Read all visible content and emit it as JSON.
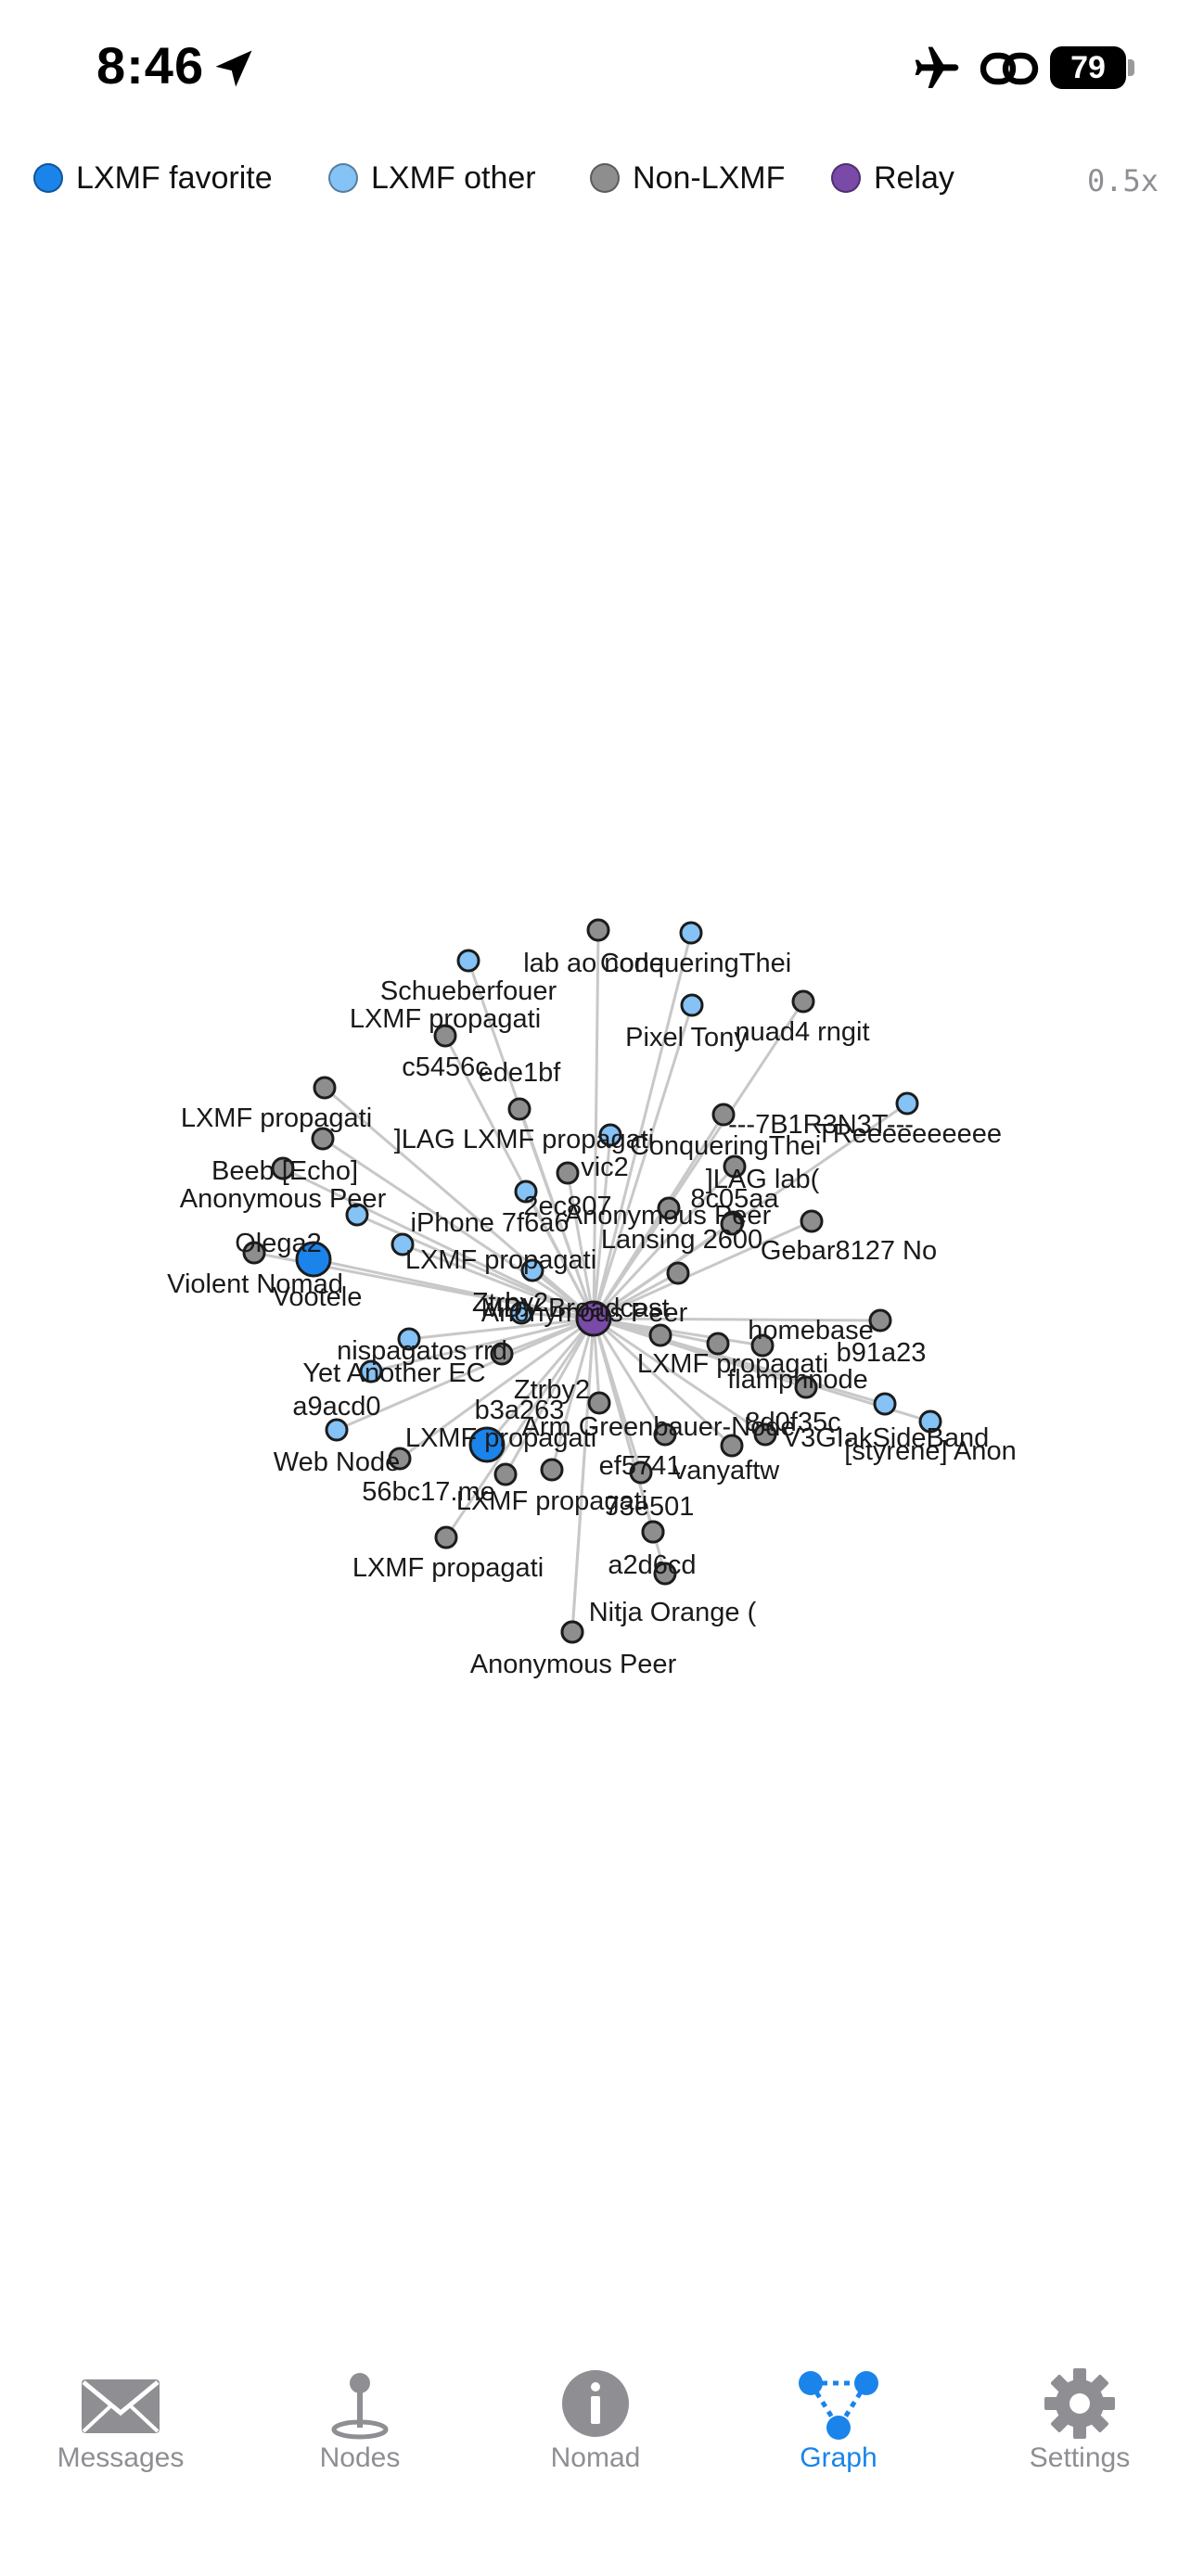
{
  "status_bar": {
    "time": "8:46",
    "battery": "79"
  },
  "legend": {
    "items": [
      {
        "label": "LXMF favorite",
        "color": "#1a84ea"
      },
      {
        "label": "LXMF other",
        "color": "#85c2f5"
      },
      {
        "label": "Non-LXMF",
        "color": "#8e8e8e"
      },
      {
        "label": "Relay",
        "color": "#7a4aa8"
      }
    ],
    "zoom": "0.5x"
  },
  "graph": {
    "edge_color": "#c8c8c8",
    "nodes": [
      {
        "label": "MDV Broadcast",
        "kind": "relay"
      },
      {
        "label": "Olega2",
        "kind": "favorite"
      },
      {
        "label": "LXMF propagati",
        "kind": "favorite"
      },
      {
        "label": "lab ao node",
        "kind": "non"
      },
      {
        "label": "ConqueringThei",
        "kind": "other"
      },
      {
        "label": "Schueberfouer",
        "kind": "other"
      },
      {
        "label": "LXMF propagati",
        "kind": "non"
      },
      {
        "label": "Pixel Tony",
        "kind": "other"
      },
      {
        "label": "nuad4 rngit",
        "kind": "non"
      },
      {
        "label": "c5456c",
        "kind": "non"
      },
      {
        "label": "ede1bf",
        "kind": "non"
      },
      {
        "label": "LXMF propagati",
        "kind": "non"
      },
      {
        "label": "]LAG LXMF propagati",
        "kind": "other"
      },
      {
        "label": "---7B1R3N3T---",
        "kind": "non"
      },
      {
        "label": "ConqueringThei",
        "kind": "non"
      },
      {
        "label": "TReeeeeeeeee",
        "kind": "other"
      },
      {
        "label": "Beeb [Echo]",
        "kind": "non"
      },
      {
        "label": "vic2",
        "kind": "non"
      },
      {
        "label": "]LAG lab(",
        "kind": "non"
      },
      {
        "label": "Anonymous Peer",
        "kind": "other"
      },
      {
        "label": "2ec807",
        "kind": "other"
      },
      {
        "label": "8c05aa",
        "kind": "non"
      },
      {
        "label": "iPhone 7f6a6",
        "kind": "other"
      },
      {
        "label": "Anonymous Peer",
        "kind": "non"
      },
      {
        "label": "Lansing 2600",
        "kind": "non"
      },
      {
        "label": "LXMF propagati",
        "kind": "other"
      },
      {
        "label": "Gebar8127 No",
        "kind": "non"
      },
      {
        "label": "Violent Nomad",
        "kind": "non"
      },
      {
        "label": "Vootele",
        "kind": "other"
      },
      {
        "label": "Ztrby2",
        "kind": "other"
      },
      {
        "label": "Anonymous Peer",
        "kind": "non"
      },
      {
        "label": "homebase",
        "kind": "non"
      },
      {
        "label": "nispagatos rrd",
        "kind": "other"
      },
      {
        "label": "b91a23",
        "kind": "non"
      },
      {
        "label": "Yet Another EC",
        "kind": "non"
      },
      {
        "label": "LXMF propagati",
        "kind": "non"
      },
      {
        "label": "flamphnode",
        "kind": "non"
      },
      {
        "label": "Ztrby2",
        "kind": "non"
      },
      {
        "label": "a9acd0",
        "kind": "other"
      },
      {
        "label": "b3a263",
        "kind": "non"
      },
      {
        "label": "Arm Greenbauer-Node",
        "kind": "non"
      },
      {
        "label": "8d0f35c",
        "kind": "non"
      },
      {
        "label": "V3GIakSideBand",
        "kind": "other"
      },
      {
        "label": "Web Node",
        "kind": "non"
      },
      {
        "label": "[styrene] Anon",
        "kind": "other"
      },
      {
        "label": "ef5741",
        "kind": "non"
      },
      {
        "label": "vanyaftw",
        "kind": "non"
      },
      {
        "label": "56bc17.me",
        "kind": "non"
      },
      {
        "label": "LXMF propagati",
        "kind": "non"
      },
      {
        "label": "73e501",
        "kind": "non"
      },
      {
        "label": "LXMF propagati",
        "kind": "non"
      },
      {
        "label": "a2d6cd",
        "kind": "non"
      },
      {
        "label": "Nitja Orange (",
        "kind": "non"
      },
      {
        "label": "Anonymous Peer",
        "kind": "non"
      }
    ]
  },
  "tabbar": {
    "tabs": [
      {
        "label": "Messages",
        "icon": "envelope-icon",
        "active": false
      },
      {
        "label": "Nodes",
        "icon": "map-pin-icon",
        "active": false
      },
      {
        "label": "Nomad",
        "icon": "info-circle-icon",
        "active": false
      },
      {
        "label": "Graph",
        "icon": "network-graph-icon",
        "active": true
      },
      {
        "label": "Settings",
        "icon": "gear-icon",
        "active": false
      }
    ],
    "active_color": "#1a84ea",
    "inactive_color": "#8e8e93"
  }
}
